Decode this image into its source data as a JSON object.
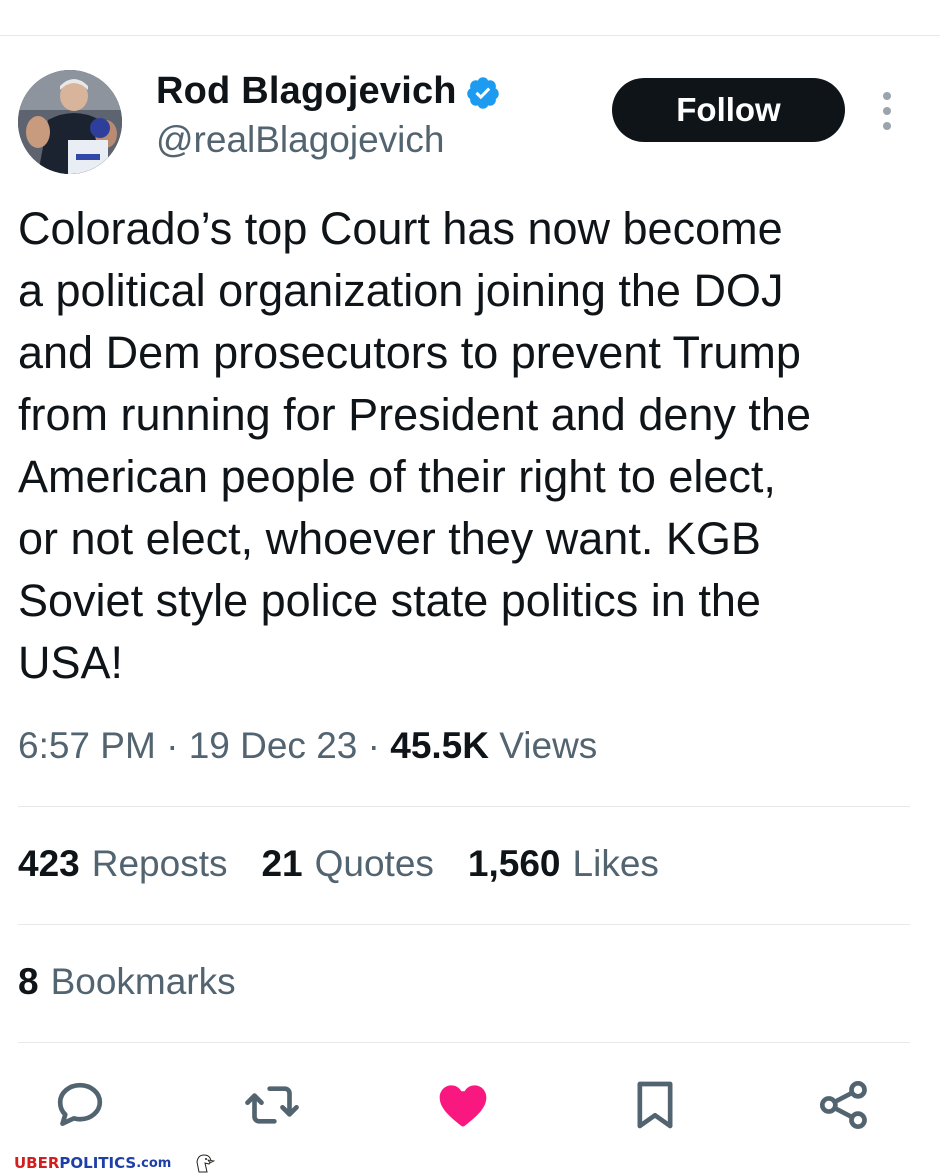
{
  "author": {
    "display_name": "Rod Blagojevich",
    "handle": "@realBlagojevich",
    "verified": true
  },
  "header": {
    "follow_label": "Follow"
  },
  "tweet": {
    "text": "Colorado’s top Court has now become\na political organization joining the DOJ\nand Dem prosecutors to prevent Trump\nfrom running for President and deny the\nAmerican people of their right to elect,\nor not elect, whoever they want. KGB\nSoviet style police state politics in the\nUSA!",
    "time": "6:57 PM",
    "separator": "·",
    "date": "19 Dec 23",
    "views_count": "45.5K",
    "views_label": "Views"
  },
  "stats": {
    "reposts": {
      "count": "423",
      "label": "Reposts"
    },
    "quotes": {
      "count": "21",
      "label": "Quotes"
    },
    "likes": {
      "count": "1,560",
      "label": "Likes"
    },
    "bookmarks": {
      "count": "8",
      "label": "Bookmarks"
    }
  },
  "actions": [
    {
      "name": "reply-icon"
    },
    {
      "name": "repost-icon"
    },
    {
      "name": "like-icon",
      "active": true
    },
    {
      "name": "bookmark-icon"
    },
    {
      "name": "share-icon"
    }
  ],
  "colors": {
    "text": "#0f1419",
    "secondary_text": "#536471",
    "verified_badge": "#1d9bf0",
    "like_active": "#f91880",
    "follow_button_bg": "#0f1419"
  },
  "watermark": {
    "part1": "UBER",
    "part2": "POLITICS",
    "part3": ".com"
  }
}
